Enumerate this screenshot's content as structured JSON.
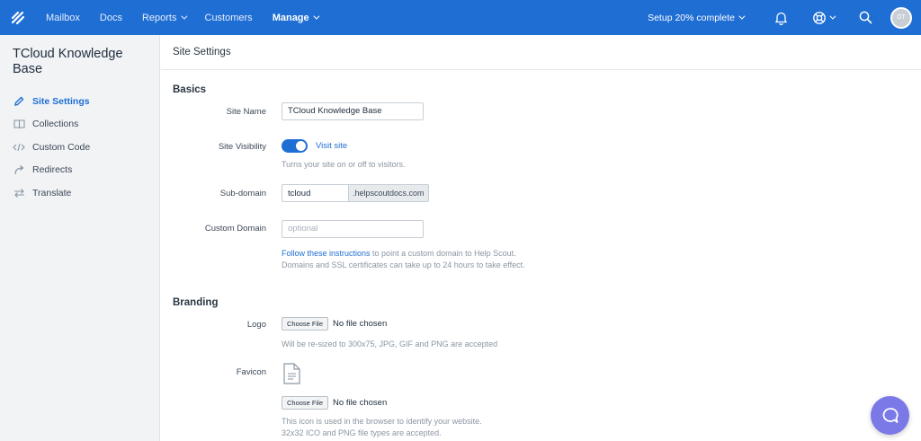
{
  "nav": {
    "items": [
      {
        "label": "Mailbox"
      },
      {
        "label": "Docs"
      },
      {
        "label": "Reports"
      },
      {
        "label": "Customers"
      },
      {
        "label": "Manage"
      }
    ],
    "setup_label": "Setup 20% complete",
    "avatar_initials": "DT"
  },
  "sidebar": {
    "title": "TCloud Knowledge Base",
    "items": [
      {
        "label": "Site Settings",
        "icon": "pencil-icon"
      },
      {
        "label": "Collections",
        "icon": "book-icon"
      },
      {
        "label": "Custom Code",
        "icon": "code-icon"
      },
      {
        "label": "Redirects",
        "icon": "redirect-arrow-icon"
      },
      {
        "label": "Translate",
        "icon": "translate-arrows-icon"
      }
    ]
  },
  "main": {
    "title": "Site Settings",
    "basics": {
      "heading": "Basics",
      "site_name_label": "Site Name",
      "site_name_value": "TCloud Knowledge Base",
      "visibility_label": "Site Visibility",
      "visit_site": "Visit site",
      "visibility_help": "Turns your site on or off to visitors.",
      "subdomain_label": "Sub-domain",
      "subdomain_value": "tcloud",
      "subdomain_suffix": ".helpscoutdocs.com",
      "custom_domain_label": "Custom Domain",
      "custom_domain_placeholder": "optional",
      "custom_domain_link": "Follow these instructions",
      "custom_domain_help_1": " to point a custom domain to Help Scout.",
      "custom_domain_help_2": "Domains and SSL certificates can take up to 24 hours to take effect."
    },
    "branding": {
      "heading": "Branding",
      "logo_label": "Logo",
      "choose_file": "Choose File",
      "no_file": "No file chosen",
      "logo_help": "Will be re-sized to 300x75, JPG, GIF and PNG are accepted",
      "favicon_label": "Favicon",
      "favicon_help_1": "This icon is used in the browser to identify your website.",
      "favicon_help_2": "32x32 ICO and PNG file types are accepted."
    }
  },
  "colors": {
    "brand": "#1f6ed4",
    "beacon": "#7b78e8"
  }
}
